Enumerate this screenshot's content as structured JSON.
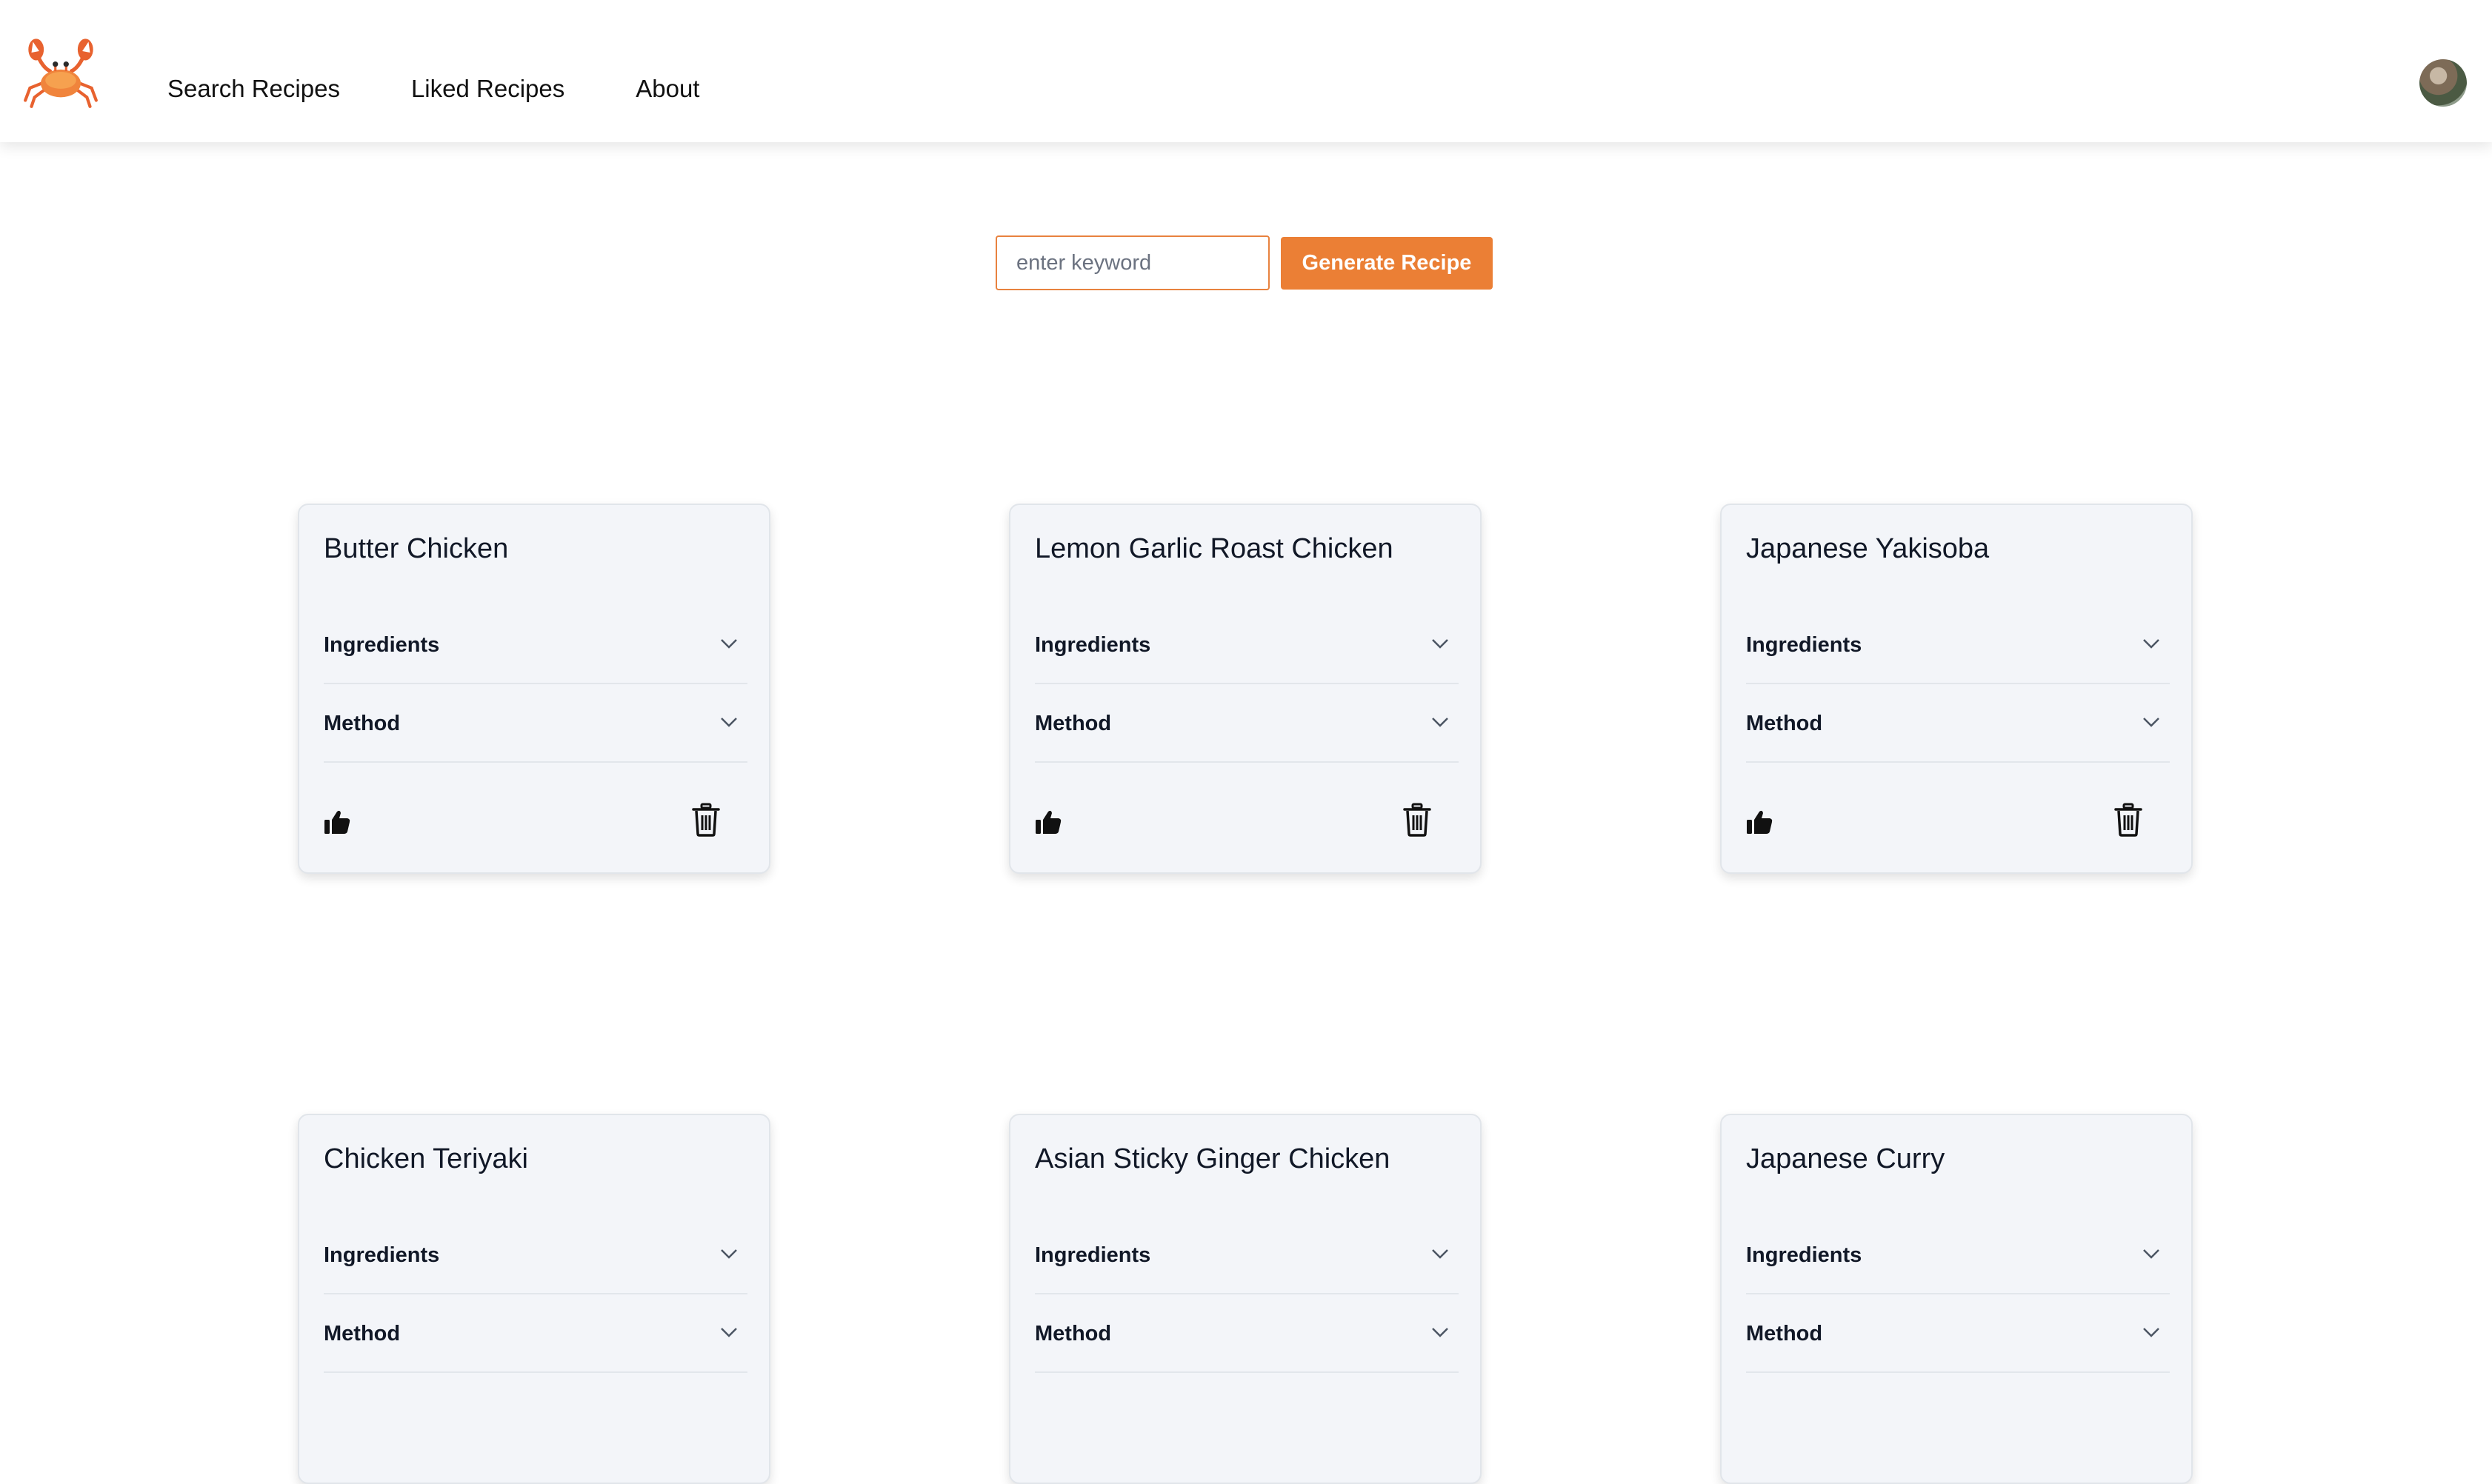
{
  "nav": {
    "logo_icon": "crab-icon",
    "links": [
      {
        "label": "Search Recipes"
      },
      {
        "label": "Liked Recipes"
      },
      {
        "label": "About"
      }
    ],
    "avatar_icon": "user-avatar"
  },
  "search": {
    "placeholder": "enter keyword",
    "button_label": "Generate Recipe"
  },
  "colors": {
    "accent": "#eb7f35",
    "card_bg": "#f3f5f9"
  },
  "recipes": [
    {
      "title": "Butter Chicken",
      "ingredients_label": "Ingredients",
      "method_label": "Method"
    },
    {
      "title": "Lemon Garlic Roast Chicken",
      "ingredients_label": "Ingredients",
      "method_label": "Method"
    },
    {
      "title": "Japanese Yakisoba",
      "ingredients_label": "Ingredients",
      "method_label": "Method"
    },
    {
      "title": "Chicken Teriyaki",
      "ingredients_label": "Ingredients",
      "method_label": "Method"
    },
    {
      "title": "Asian Sticky Ginger Chicken",
      "ingredients_label": "Ingredients",
      "method_label": "Method"
    },
    {
      "title": "Japanese Curry",
      "ingredients_label": "Ingredients",
      "method_label": "Method"
    }
  ],
  "card_icons": {
    "like": "thumbs-up-icon",
    "delete": "trash-icon",
    "expand": "chevron-down-icon"
  }
}
